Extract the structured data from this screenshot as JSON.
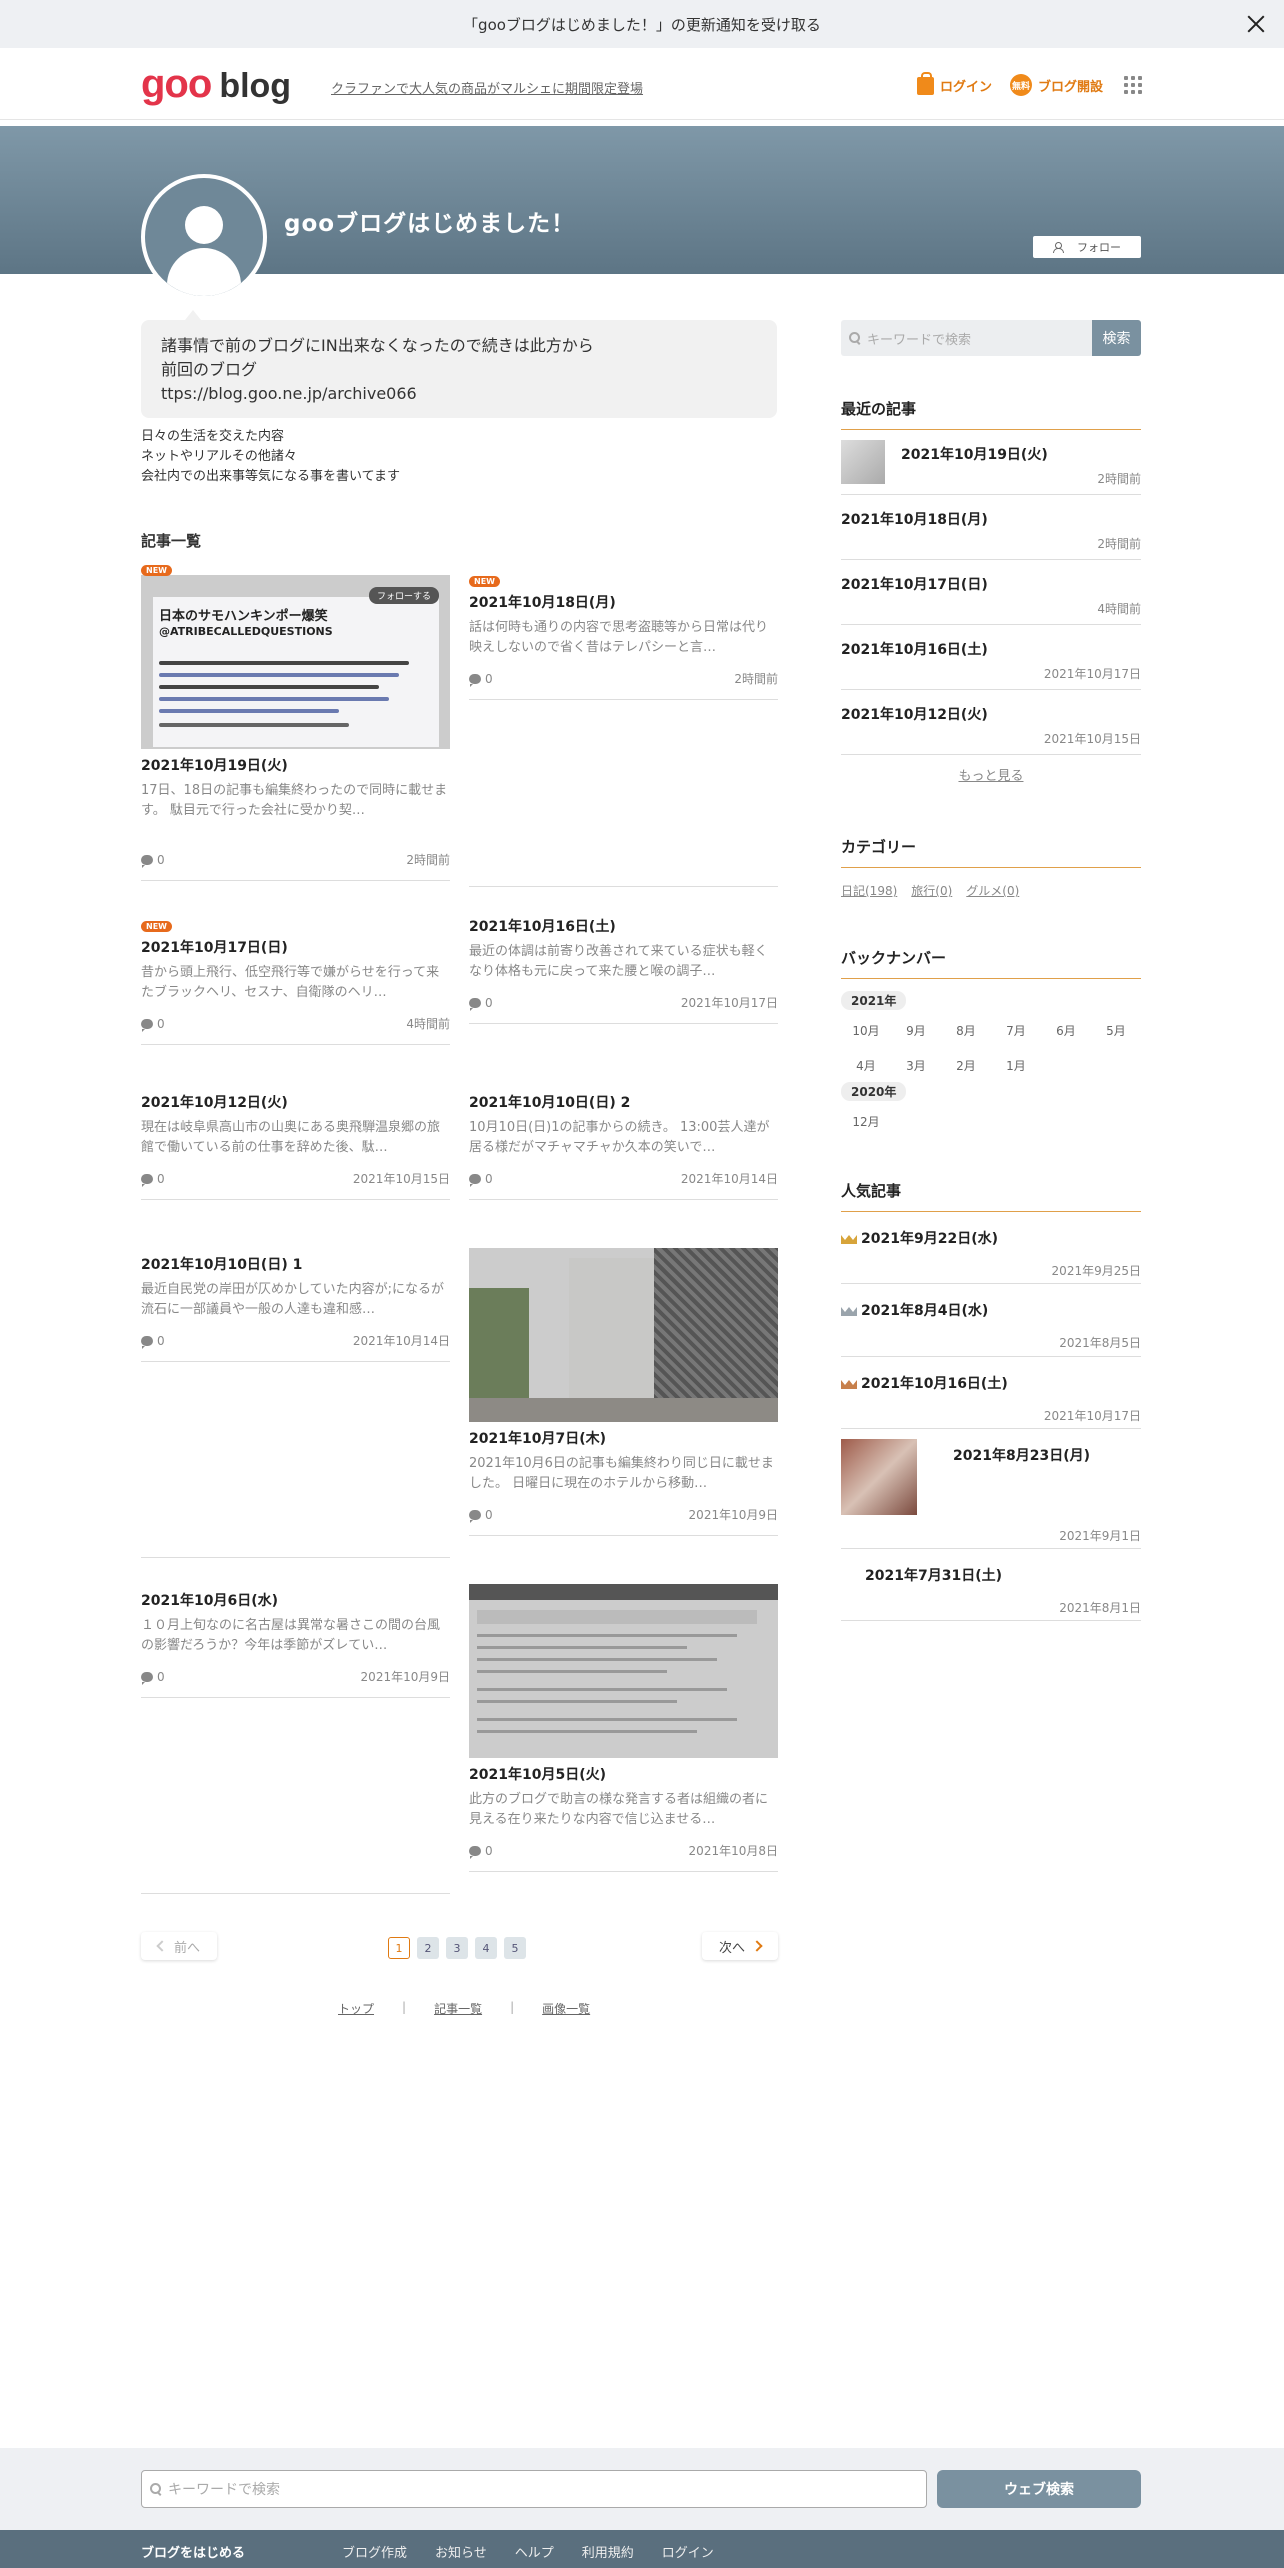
{
  "notification": {
    "text": "「gooブログはじめました！」の更新通知を受け取る"
  },
  "header": {
    "logo_goo": "goo",
    "logo_blog": "blog",
    "promo": "クラファンで大人気の商品がマルシェに期間限定登場",
    "login": "ログイン",
    "free_badge": "無料",
    "open_blog": "ブログ開設"
  },
  "profile": {
    "title": "gooブログはじめました！",
    "follow": "フォロー"
  },
  "intro": {
    "lines": [
      "諸事情で前のブログにIN出来なくなったので続きは此方から",
      "前回のブログ",
      "ttps://blog.goo.ne.jp/archive066"
    ]
  },
  "description": {
    "lines": [
      "日々の生活を交えた内容",
      "ネットやリアルその他諸々",
      "会社内での出来事等気になる事を書いてます"
    ]
  },
  "articles": {
    "heading": "記事一覧",
    "new_badge": "NEW",
    "thumb1": {
      "title": "日本のサモハンキンポー爆笑",
      "handle": "@ATRIBECALLEDQUESTIONS",
      "follow": "フォローする"
    },
    "items": [
      {
        "date": "2021年10月19日(火)",
        "excerpt": "17日、18日の記事も編集終わったので同時に載せます。 駄目元で行った会社に受かり契…",
        "comments": "0",
        "time": "2時間前"
      },
      {
        "date": "2021年10月18日(月)",
        "excerpt": "話は何時も通りの内容で思考盗聴等から日常は代り映えしないので省く昔はテレパシーと言…",
        "comments": "0",
        "time": "2時間前"
      },
      {
        "date": "2021年10月17日(日)",
        "excerpt": "昔から頭上飛行、低空飛行等で嫌がらせを行って来たブラックヘリ、セスナ、自衛隊のヘリ…",
        "comments": "0",
        "time": "4時間前"
      },
      {
        "date": "2021年10月16日(土)",
        "excerpt": "最近の体調は前寄り改善されて来ている症状も軽くなり体格も元に戻って来た腰と喉の調子…",
        "comments": "0",
        "time": "2021年10月17日"
      },
      {
        "date": "2021年10月12日(火)",
        "excerpt": "現在は岐阜県高山市の山奥にある奥飛騨温泉郷の旅館で働いている前の仕事を辞めた後、駄…",
        "comments": "0",
        "time": "2021年10月15日"
      },
      {
        "date": "2021年10月10日(日) 2",
        "excerpt": "10月10日(日)1の記事からの続き。 13:00芸人達が居る様だがマチャマチャか久本の笑いで…",
        "comments": "0",
        "time": "2021年10月14日"
      },
      {
        "date": "2021年10月10日(日) 1",
        "excerpt": "最近自民党の岸田が仄めかしていた内容が;になるが流石に一部議員や一般の人達も違和感…",
        "comments": "0",
        "time": "2021年10月14日"
      },
      {
        "date": "2021年10月7日(木)",
        "excerpt": "2021年10月6日の記事も編集終わり同じ日に載せました。 日曜日に現在のホテルから移動…",
        "comments": "0",
        "time": "2021年10月9日"
      },
      {
        "date": "2021年10月6日(水)",
        "excerpt": "１０月上旬なのに名古屋は異常な暑さこの間の台風の影響だろうか？今年は季節がズレてい…",
        "comments": "0",
        "time": "2021年10月9日"
      },
      {
        "date": "2021年10月5日(火)",
        "excerpt": "此方のブログで助言の様な発言する者は組織の者に見える在り来たりな内容で信じ込ませる…",
        "comments": "0",
        "time": "2021年10月8日"
      }
    ]
  },
  "pager": {
    "prev": "前へ",
    "next": "次へ",
    "pages": [
      "1",
      "2",
      "3",
      "4",
      "5"
    ]
  },
  "footer_links": [
    "トップ",
    "記事一覧",
    "画像一覧"
  ],
  "sidebar": {
    "search_placeholder": "キーワードで検索",
    "search_button": "検索",
    "recent_heading": "最近の記事",
    "recent": [
      {
        "date": "2021年10月19日(火)",
        "time": "2時間前"
      },
      {
        "date": "2021年10月18日(月)",
        "time": "2時間前"
      },
      {
        "date": "2021年10月17日(日)",
        "time": "4時間前"
      },
      {
        "date": "2021年10月16日(土)",
        "time": "2021年10月17日"
      },
      {
        "date": "2021年10月12日(火)",
        "time": "2021年10月15日"
      }
    ],
    "more": "もっと見る",
    "category_heading": "カテゴリー",
    "categories": [
      "日記(198)",
      "旅行(0)",
      "グルメ(0)"
    ],
    "backnumber_heading": "バックナンバー",
    "year1": "2021年",
    "months1": [
      "10月",
      "9月",
      "8月",
      "7月",
      "6月",
      "5月",
      "4月",
      "3月",
      "2月",
      "1月"
    ],
    "year2": "2020年",
    "months2": [
      "12月"
    ],
    "popular_heading": "人気記事",
    "popular": [
      {
        "date": "2021年9月22日(水)",
        "time": "2021年9月25日"
      },
      {
        "date": "2021年8月4日(水)",
        "time": "2021年8月5日"
      },
      {
        "date": "2021年10月16日(土)",
        "time": "2021年10月17日"
      },
      {
        "date": "2021年8月23日(月)",
        "time": "2021年9月1日"
      },
      {
        "date": "2021年7月31日(土)",
        "time": "2021年8月1日"
      }
    ]
  },
  "footer": {
    "search_placeholder": "キーワードで検索",
    "web_search": "ウェブ検索",
    "start_blog": "ブログをはじめる",
    "links": [
      "ブログ作成",
      "お知らせ",
      "ヘルプ",
      "利用規約",
      "ログイン"
    ]
  },
  "colors": {
    "accent": "#e07a12",
    "banner": "#6f8898",
    "button": "#7a91a0"
  }
}
